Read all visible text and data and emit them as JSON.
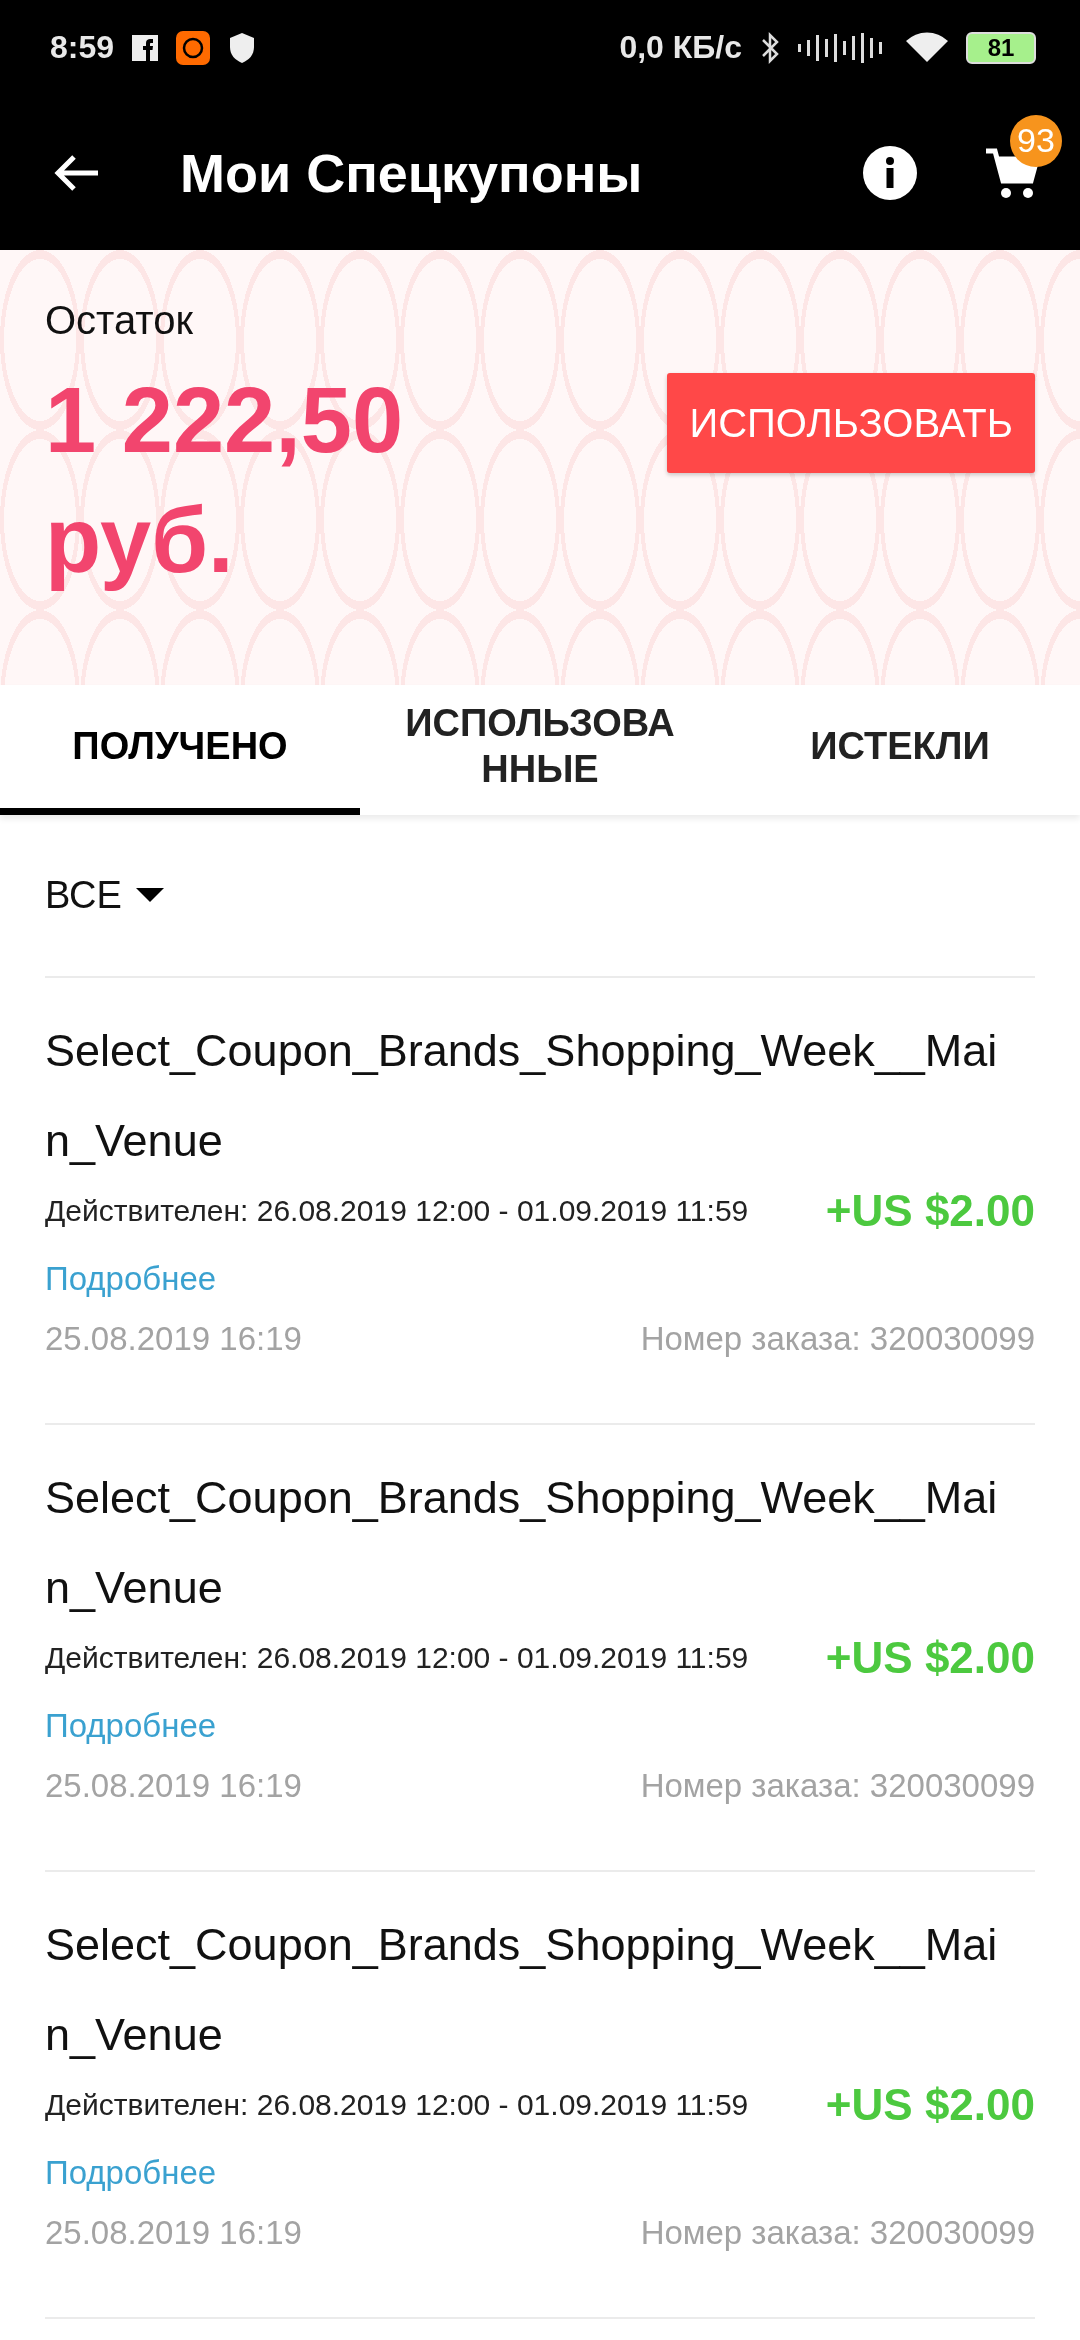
{
  "status_bar": {
    "time": "8:59",
    "network_speed": "0,0 КБ/с",
    "battery": "81"
  },
  "app_bar": {
    "title": "Мои Спецкупоны",
    "cart_count": "93"
  },
  "balance": {
    "label": "Остаток",
    "amount": "1 222,50 руб.",
    "button": "ИСПОЛЬЗОВАТЬ"
  },
  "tabs": [
    {
      "label": "ПОЛУЧЕНО",
      "selected": true
    },
    {
      "label": "ИСПОЛЬЗОВАННЫЕ",
      "selected": false
    },
    {
      "label": "ИСТЕКЛИ",
      "selected": false
    }
  ],
  "filter": {
    "label": "ВСЕ"
  },
  "coupons": [
    {
      "title": "Select_Coupon_Brands_Shopping_Week__Main_Venue",
      "validity": "Действителен: 26.08.2019 12:00 - 01.09.2019 11:59",
      "link": "Подробнее",
      "amount": "+US $2.00",
      "date": "25.08.2019 16:19",
      "order": "Номер заказа: 320030099"
    },
    {
      "title": "Select_Coupon_Brands_Shopping_Week__Main_Venue",
      "validity": "Действителен: 26.08.2019 12:00 - 01.09.2019 11:59",
      "link": "Подробнее",
      "amount": "+US $2.00",
      "date": "25.08.2019 16:19",
      "order": "Номер заказа: 320030099"
    },
    {
      "title": "Select_Coupon_Brands_Shopping_Week__Main_Venue",
      "validity": "Действителен: 26.08.2019 12:00 - 01.09.2019 11:59",
      "link": "Подробнее",
      "amount": "+US $2.00",
      "date": "25.08.2019 16:19",
      "order": "Номер заказа: 320030099"
    }
  ]
}
